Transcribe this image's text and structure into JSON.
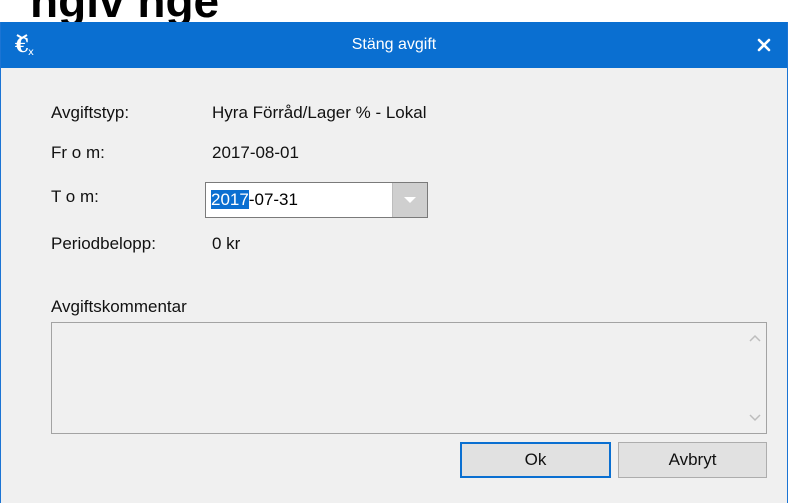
{
  "background": {
    "heading_fragment": "ngiv   nge"
  },
  "window": {
    "title": "Stäng avgift",
    "title_icon": "close-fee-icon",
    "close_icon": "close-icon",
    "accent_color": "#0a6fd1"
  },
  "fields": {
    "fee_type_label": "Avgiftstyp:",
    "fee_type_value": "Hyra Förråd/Lager % - Lokal",
    "from_label": "Fr o m:",
    "from_value": "2017-08-01",
    "to_label": "T o m:",
    "to_value_selected": "2017",
    "to_value_rest": "-07-31",
    "period_amount_label": "Periodbelopp:",
    "period_amount_value": "0 kr"
  },
  "comment": {
    "label": "Avgiftskommentar",
    "value": ""
  },
  "buttons": {
    "ok": "Ok",
    "cancel": "Avbryt"
  }
}
